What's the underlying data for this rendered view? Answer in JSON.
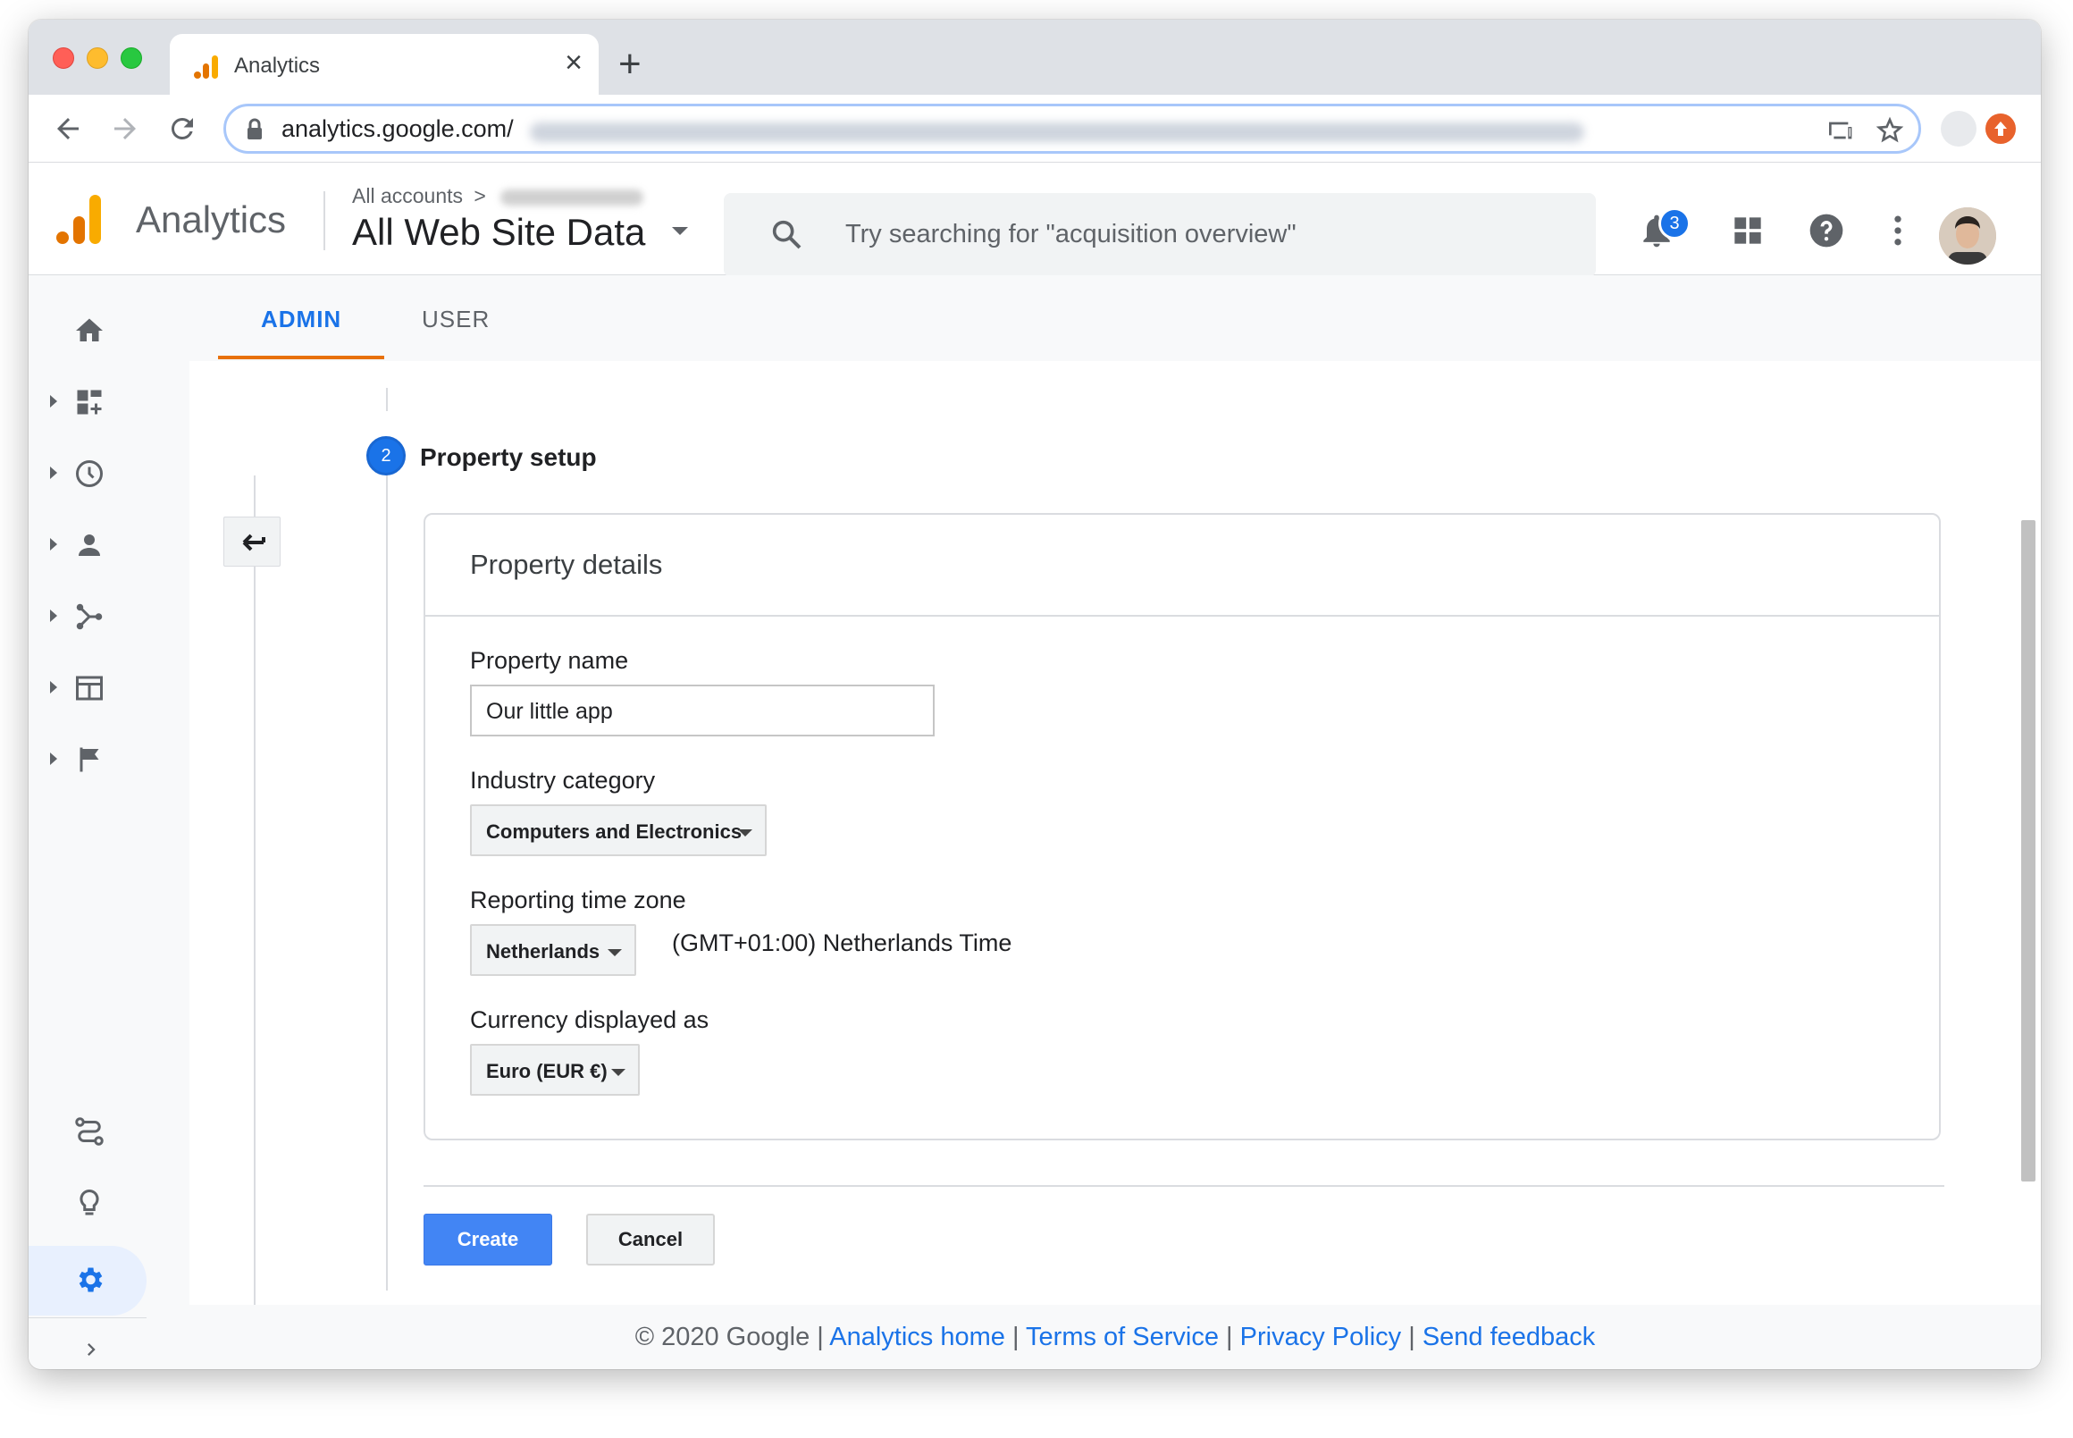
{
  "browser": {
    "tab_title": "Analytics",
    "tab_close": "×",
    "new_tab": "+",
    "url": "analytics.google.com/"
  },
  "header": {
    "app_name": "Analytics",
    "breadcrumb": "All accounts",
    "breadcrumb_separator": ">",
    "view_name": "All Web Site Data",
    "search_placeholder": "Try searching for \"acquisition overview\"",
    "notification_count": "3"
  },
  "tabs": {
    "admin": "ADMIN",
    "user": "USER"
  },
  "step": {
    "number": "2",
    "title": "Property setup"
  },
  "card": {
    "title": "Property details",
    "property_name_label": "Property name",
    "property_name_value": "Our little app",
    "industry_label": "Industry category",
    "industry_value": "Computers and Electronics",
    "timezone_label": "Reporting time zone",
    "timezone_country": "Netherlands",
    "timezone_text": "(GMT+01:00) Netherlands Time",
    "currency_label": "Currency displayed as",
    "currency_value": "Euro (EUR €)"
  },
  "actions": {
    "create": "Create",
    "cancel": "Cancel"
  },
  "footer": {
    "copyright": "© 2020 Google",
    "sep": " | ",
    "analytics_home": "Analytics home",
    "terms": "Terms of Service",
    "privacy": "Privacy Policy",
    "feedback": "Send feedback"
  },
  "colors": {
    "accent": "#1a73e8",
    "tab_underline": "#e8710a",
    "create_button": "#4285f4",
    "logo_orange": "#e37400",
    "logo_yellow": "#f9ab00"
  },
  "icons": {
    "rail": [
      "home-icon",
      "customization-icon",
      "realtime-icon",
      "audience-icon",
      "acquisition-icon",
      "behavior-icon",
      "conversions-icon",
      "attribution-icon",
      "discover-icon",
      "admin-gear-icon"
    ]
  }
}
